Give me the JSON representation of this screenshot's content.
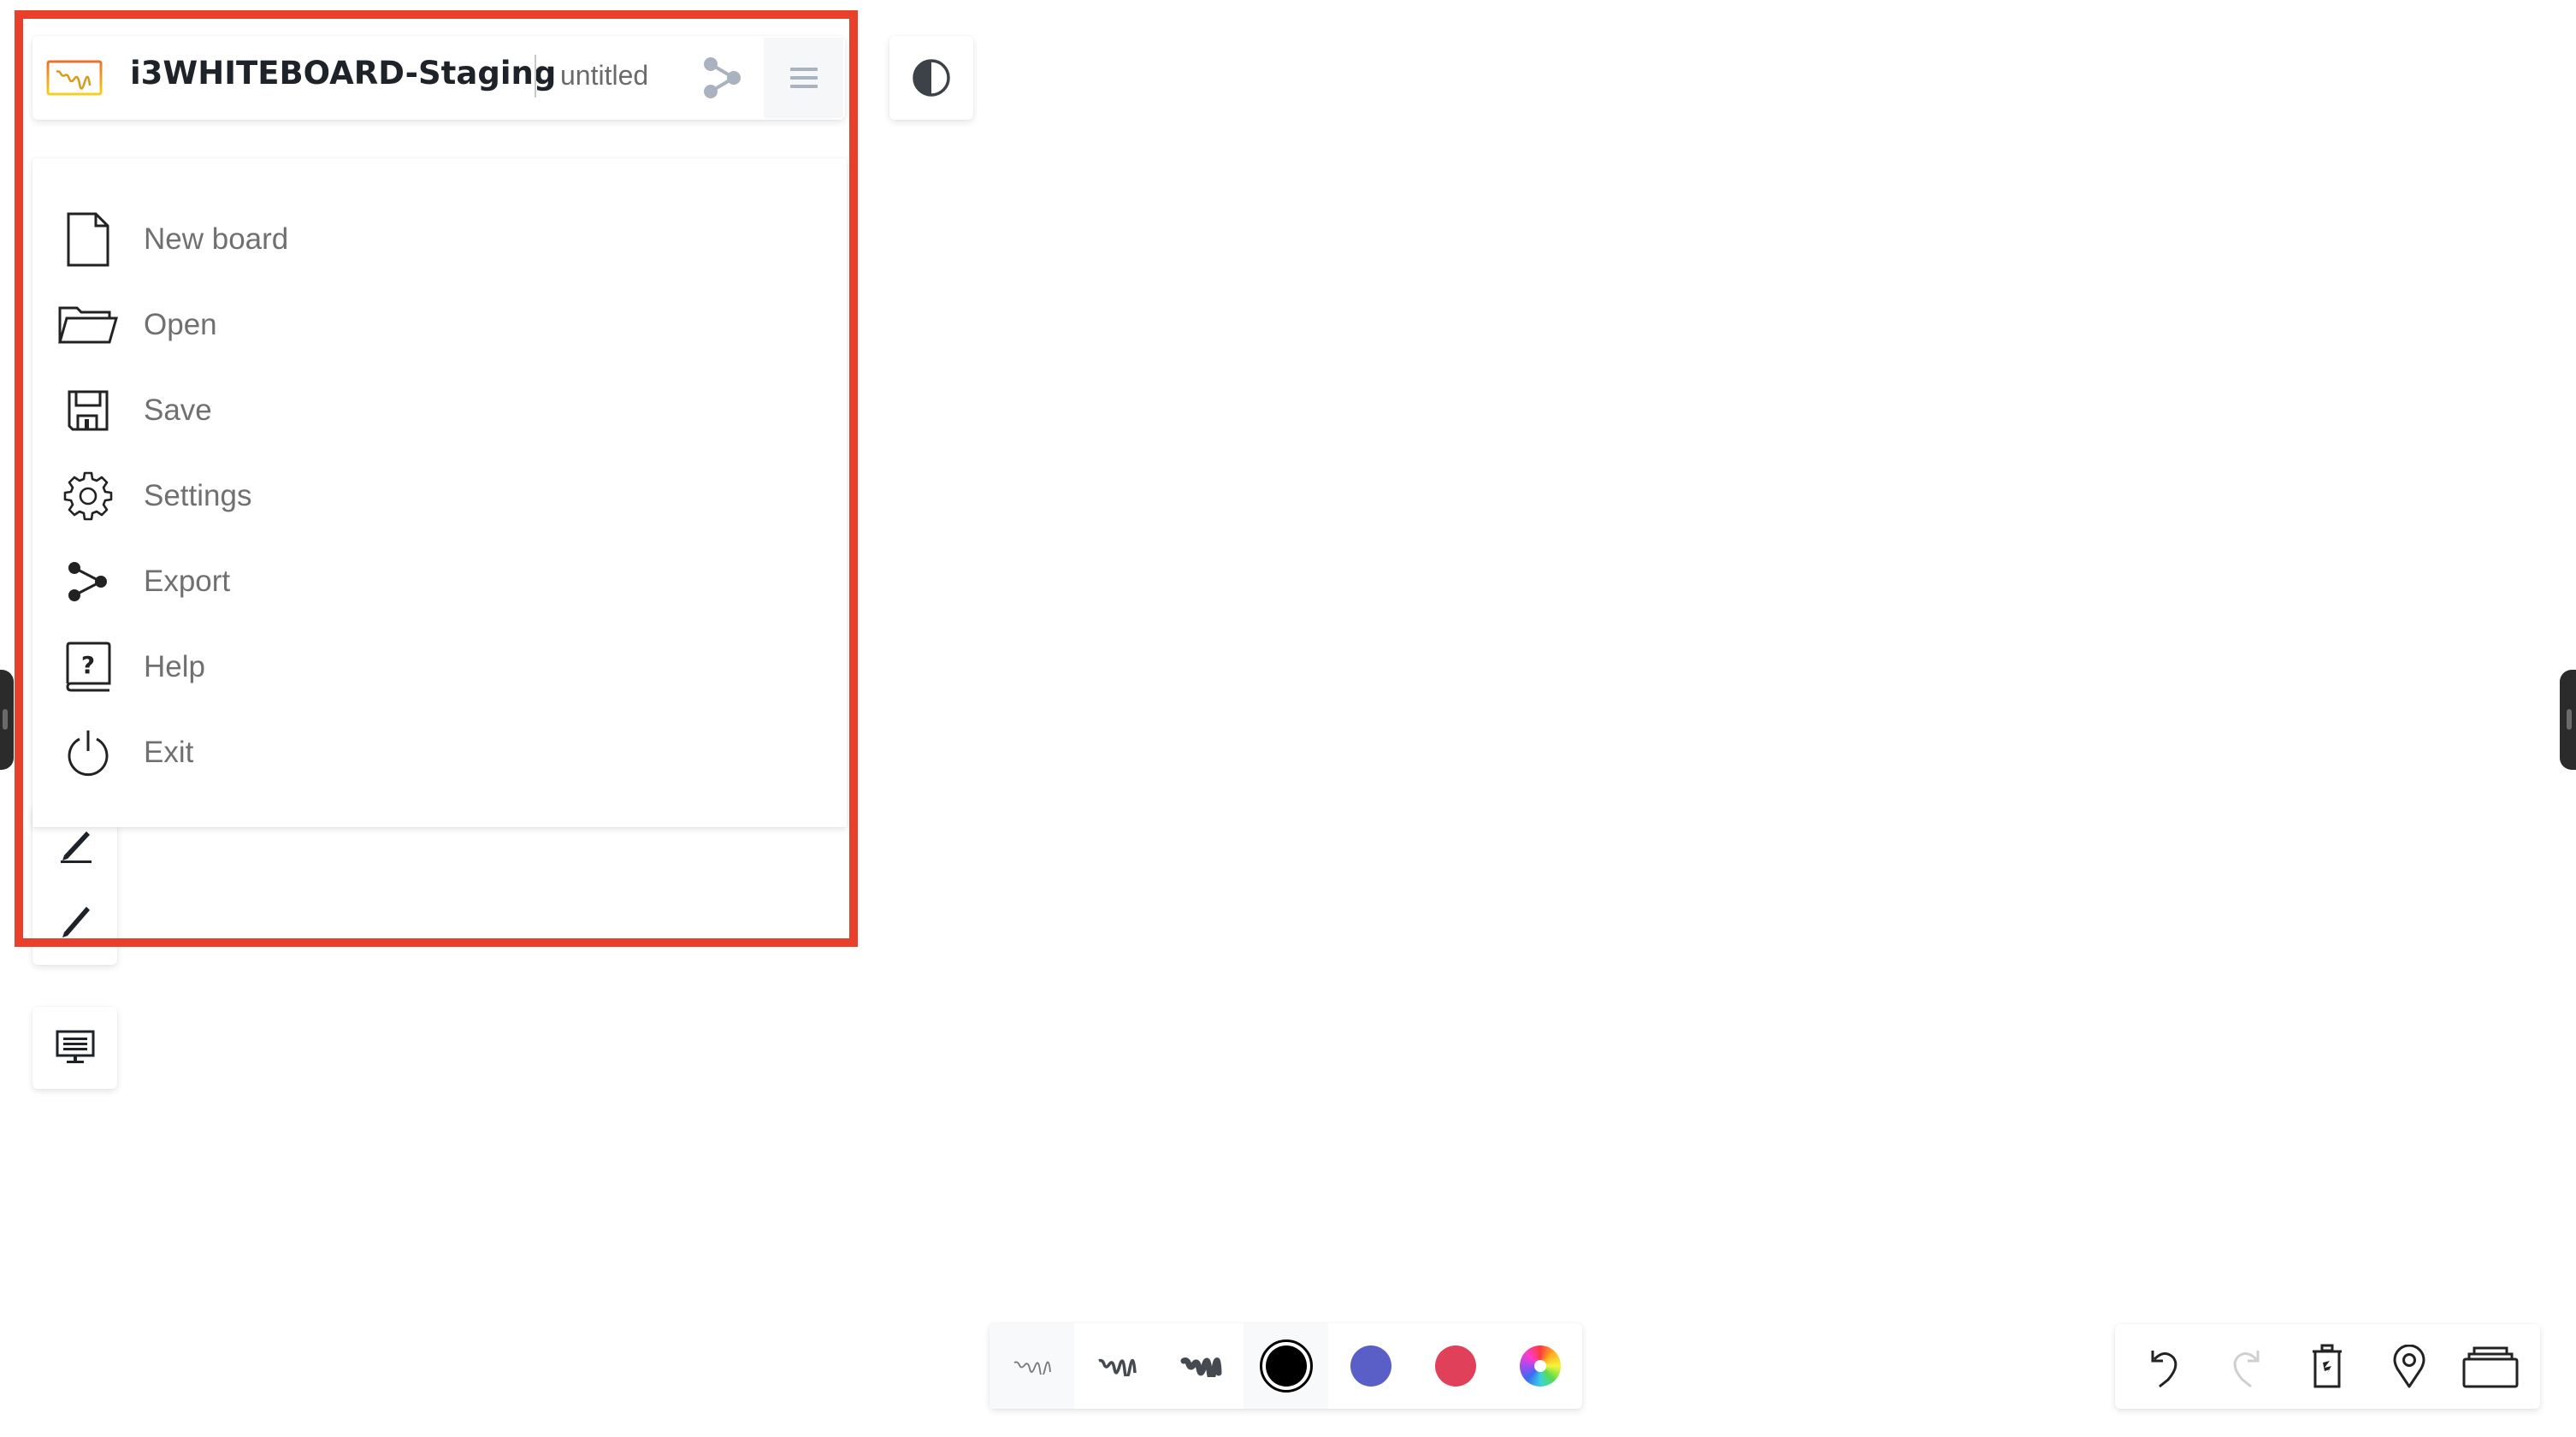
{
  "header": {
    "app_title": "i3WHITEBOARD-Staging",
    "board_name": "untitled",
    "logo_icon": "whiteboard-logo-icon",
    "share_icon": "share-icon",
    "menu_icon": "hamburger-menu-icon"
  },
  "theme_toggle": {
    "icon": "contrast-icon"
  },
  "menu": {
    "items": [
      {
        "label": "New board",
        "icon": "new-file-icon"
      },
      {
        "label": "Open",
        "icon": "folder-open-icon"
      },
      {
        "label": "Save",
        "icon": "floppy-disk-icon"
      },
      {
        "label": "Settings",
        "icon": "gear-icon"
      },
      {
        "label": "Export",
        "icon": "share-icon"
      },
      {
        "label": "Help",
        "icon": "help-book-icon"
      },
      {
        "label": "Exit",
        "icon": "power-icon"
      }
    ]
  },
  "left_toolbar": {
    "tools": [
      {
        "name": "pen",
        "icon": "pen-icon",
        "underline_color": "#222222"
      },
      {
        "name": "highlighter",
        "icon": "highlighter-icon",
        "underline_color": "#e0406a"
      }
    ],
    "present": {
      "icon": "presentation-icon"
    }
  },
  "color_toolbar": {
    "stroke_widths": [
      "thin",
      "medium",
      "thick"
    ],
    "selected_stroke": "thin",
    "colors": [
      {
        "name": "black",
        "hex": "#000000",
        "selected": true
      },
      {
        "name": "blue",
        "hex": "#5a5fc8",
        "selected": false
      },
      {
        "name": "red",
        "hex": "#e0405a",
        "selected": false
      }
    ],
    "custom_color_icon": "color-wheel-icon"
  },
  "action_toolbar": {
    "buttons": [
      {
        "name": "undo",
        "icon": "undo-icon",
        "enabled": true
      },
      {
        "name": "redo",
        "icon": "redo-icon",
        "enabled": false
      },
      {
        "name": "clear",
        "icon": "trash-icon",
        "enabled": true
      },
      {
        "name": "locate",
        "icon": "location-pin-icon",
        "enabled": true
      },
      {
        "name": "boards",
        "icon": "stacked-boards-icon",
        "enabled": true
      }
    ]
  },
  "annotation": {
    "highlight_color": "#e8402a"
  }
}
